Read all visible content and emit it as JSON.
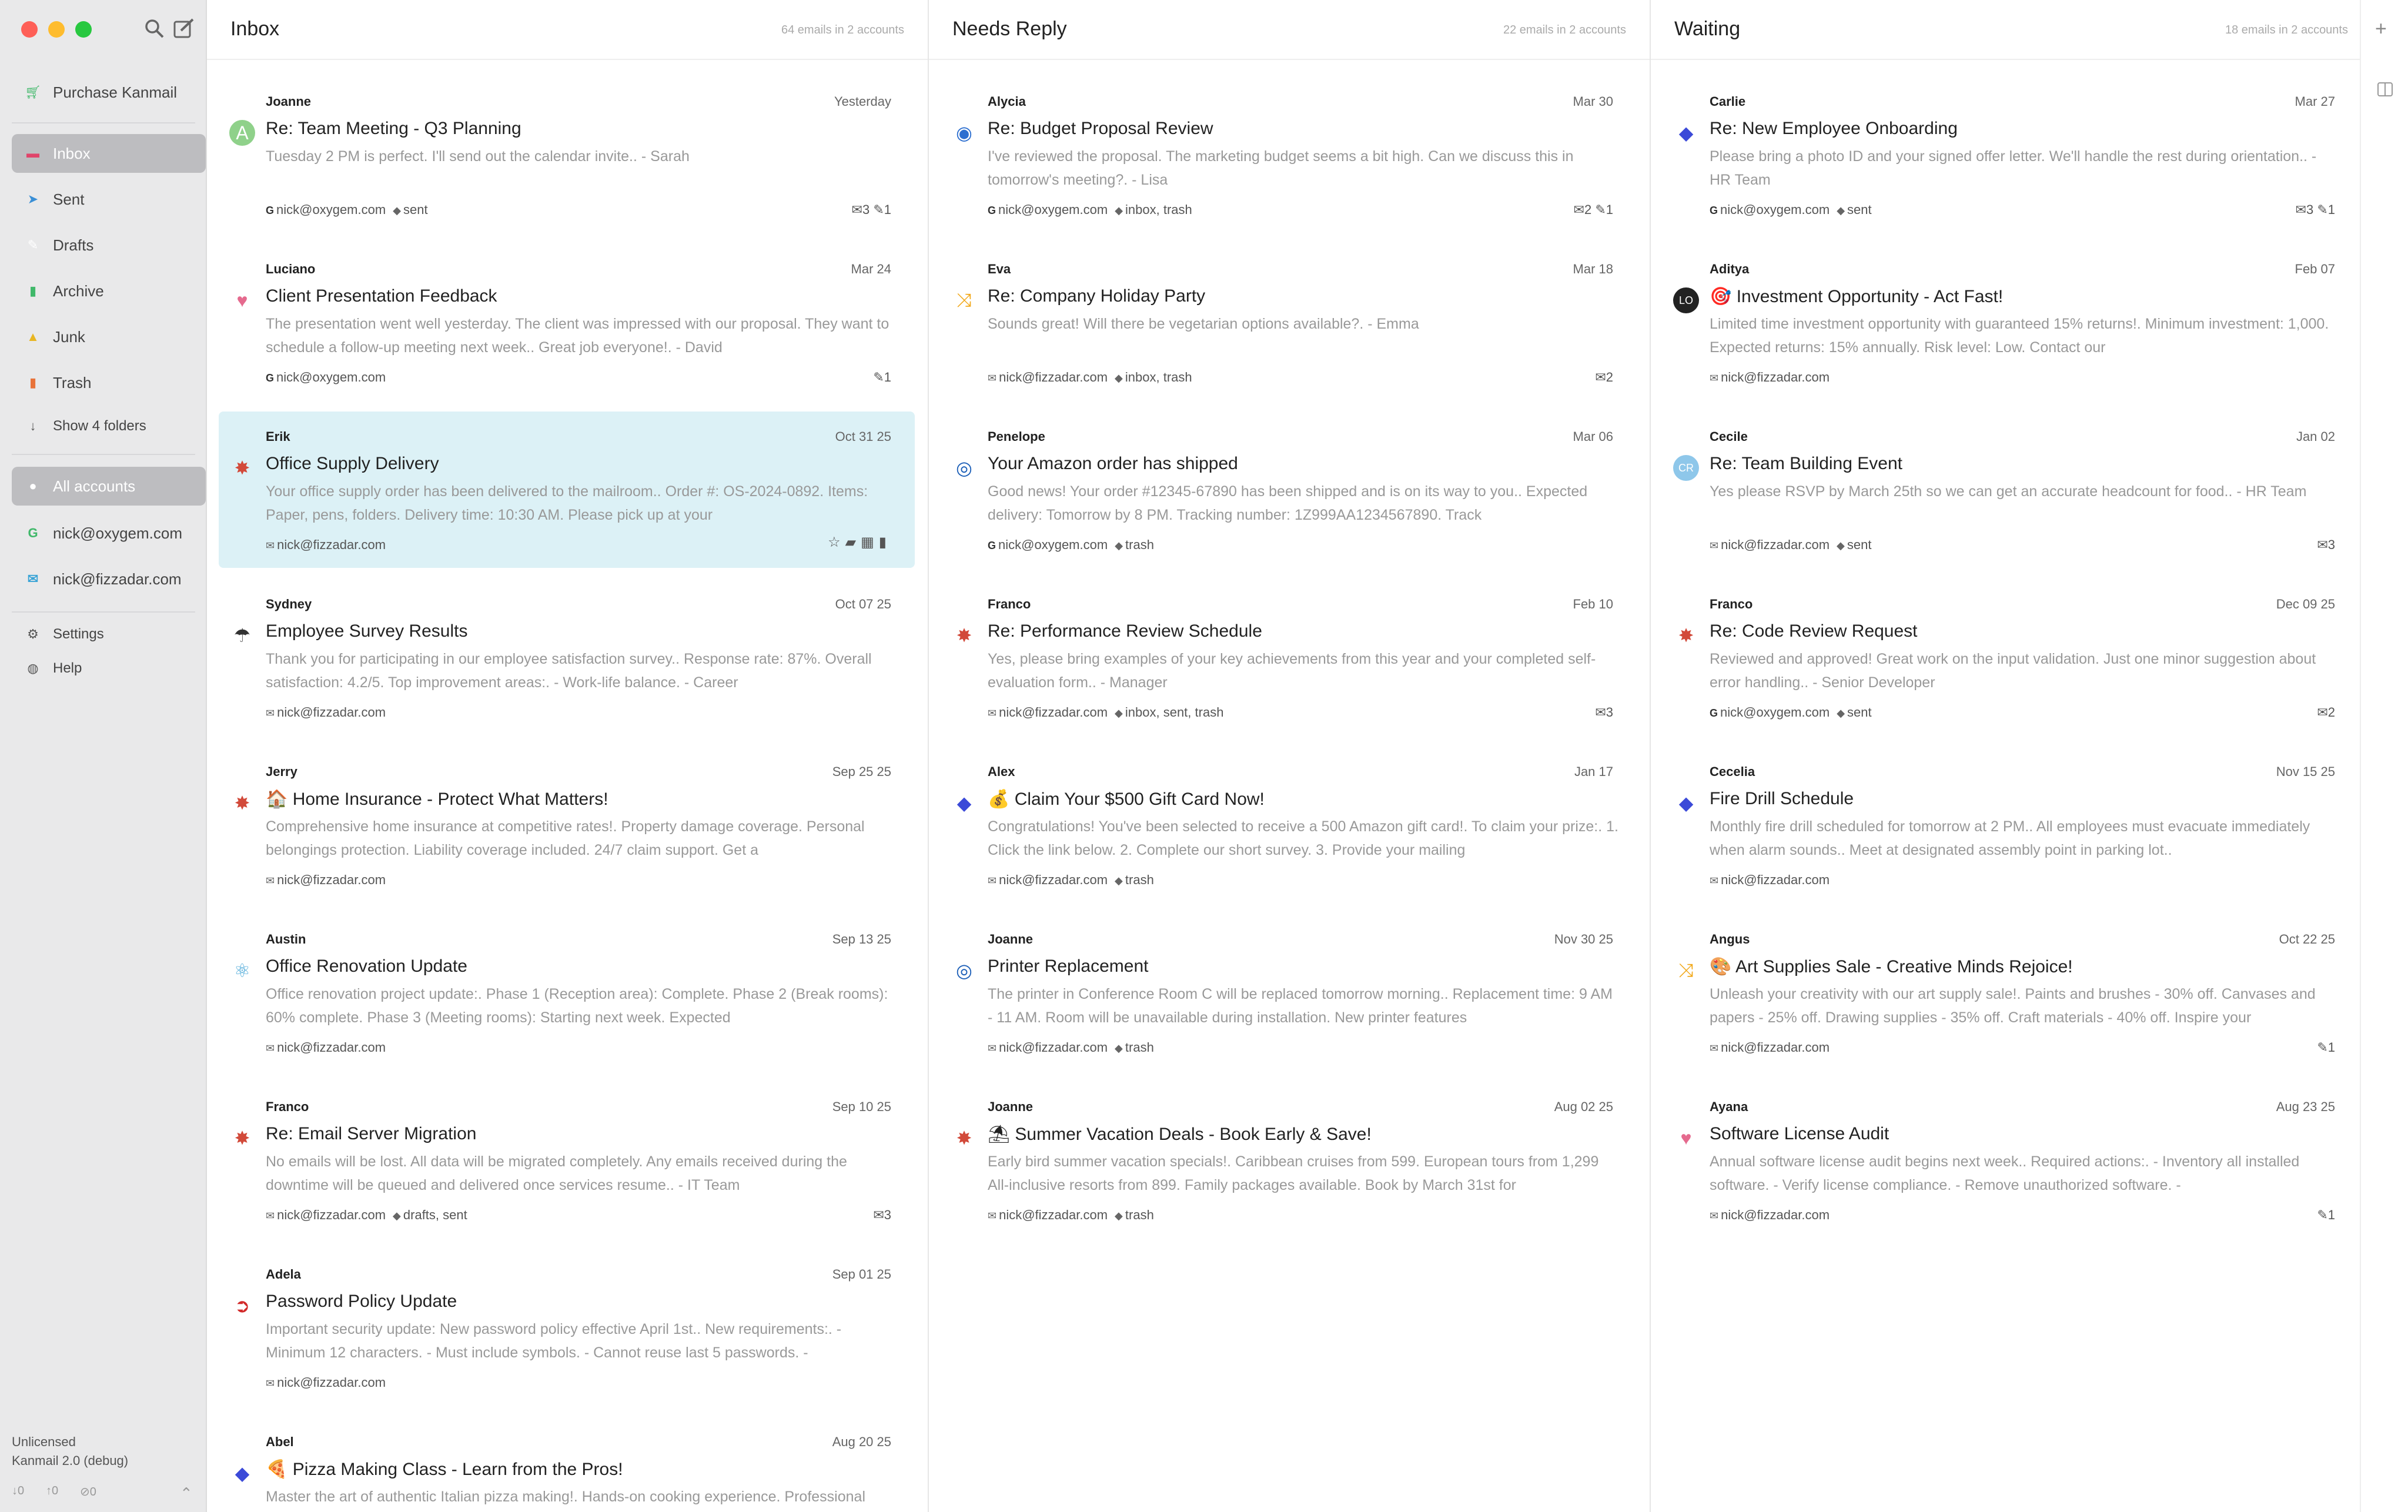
{
  "sidebar": {
    "purchase": "Purchase Kanmail",
    "folders": [
      {
        "label": "Inbox",
        "icon": "inbox-icon",
        "color": "#e0446a",
        "active": true
      },
      {
        "label": "Sent",
        "icon": "paper-plane-icon",
        "color": "#3a8fd6"
      },
      {
        "label": "Drafts",
        "icon": "pencil-icon",
        "color": "#ffffff"
      },
      {
        "label": "Archive",
        "icon": "archive-icon",
        "color": "#40b86a"
      },
      {
        "label": "Junk",
        "icon": "warning-icon",
        "color": "#e8b623"
      },
      {
        "label": "Trash",
        "icon": "trash-icon",
        "color": "#e8733a"
      }
    ],
    "show_folders": "Show 4 folders",
    "all_accounts": "All accounts",
    "accounts": [
      {
        "label": "nick@oxygem.com",
        "icon": "google-icon",
        "color": "#40b86a"
      },
      {
        "label": "nick@fizzadar.com",
        "icon": "envelope-icon",
        "color": "#3aa4d6"
      }
    ],
    "settings": "Settings",
    "help": "Help",
    "license": "Unlicensed",
    "version": "Kanmail 2.0 (debug)",
    "counters": [
      "0",
      "0",
      "0"
    ]
  },
  "columns": [
    {
      "title": "Inbox",
      "count": "64 emails in 2 accounts",
      "emails": [
        {
          "sender": "Joanne",
          "date": "Yesterday",
          "subject": "Re: Team Meeting - Q3 Planning",
          "preview": "Tuesday 2 PM is perfect. I'll send out the calendar invite.. - Sarah",
          "account": "nick@oxygem.com",
          "account_icon": "google-icon",
          "tags": "sent",
          "counts": "✉3 ✎1",
          "logo": "A",
          "logo_color": "#8fd18a"
        },
        {
          "sender": "Luciano",
          "date": "Mar 24",
          "subject": "Client Presentation Feedback",
          "preview": "The presentation went well yesterday. The client was impressed with our proposal. They want to schedule a follow-up meeting next week.. Great job everyone!. - David",
          "account": "nick@oxygem.com",
          "account_icon": "google-icon",
          "tags": "",
          "counts": "✎1",
          "logo": "♥",
          "logo_color": "#e56a8e"
        },
        {
          "sender": "Erik",
          "date": "Oct 31 25",
          "subject": "Office Supply Delivery",
          "preview": "Your office supply order has been delivered to the mailroom.. Order #: OS-2024-0892. Items: Paper, pens, folders. Delivery time: 10:30 AM. Please pick up at your",
          "account": "nick@fizzadar.com",
          "account_icon": "envelope-icon",
          "tags": "",
          "counts": "",
          "selected": true,
          "logo": "✸",
          "logo_color": "#d24a3a"
        },
        {
          "sender": "Sydney",
          "date": "Oct 07 25",
          "subject": "Employee Survey Results",
          "preview": "Thank you for participating in our employee satisfaction survey.. Response rate: 87%. Overall satisfaction: 4.2/5. Top improvement areas:. - Work-life balance. - Career",
          "account": "nick@fizzadar.com",
          "account_icon": "envelope-icon",
          "tags": "",
          "counts": "",
          "logo": "☂",
          "logo_color": "#333333"
        },
        {
          "sender": "Jerry",
          "date": "Sep 25 25",
          "subject": "🏠 Home Insurance - Protect What Matters!",
          "preview": "Comprehensive home insurance at competitive rates!. Property damage coverage. Personal belongings protection. Liability coverage included. 24/7 claim support. Get a",
          "account": "nick@fizzadar.com",
          "account_icon": "envelope-icon",
          "tags": "",
          "counts": "",
          "logo": "✸",
          "logo_color": "#d24a3a"
        },
        {
          "sender": "Austin",
          "date": "Sep 13 25",
          "subject": "Office Renovation Update",
          "preview": "Office renovation project update:. Phase 1 (Reception area): Complete. Phase 2 (Break rooms): 60% complete. Phase 3 (Meeting rooms): Starting next week. Expected",
          "account": "nick@fizzadar.com",
          "account_icon": "envelope-icon",
          "tags": "",
          "counts": "",
          "logo": "⚛",
          "logo_color": "#4aa8d8"
        },
        {
          "sender": "Franco",
          "date": "Sep 10 25",
          "subject": "Re: Email Server Migration",
          "preview": "No emails will be lost. All data will be migrated completely. Any emails received during the downtime will be queued and delivered once services resume.. - IT Team",
          "account": "nick@fizzadar.com",
          "account_icon": "envelope-icon",
          "tags": "drafts, sent",
          "counts": "✉3",
          "logo": "✸",
          "logo_color": "#d24a3a"
        },
        {
          "sender": "Adela",
          "date": "Sep 01 25",
          "subject": "Password Policy Update",
          "preview": "Important security update: New password policy effective April 1st.. New requirements:. - Minimum 12 characters. - Must include symbols. - Cannot reuse last 5 passwords. -",
          "account": "nick@fizzadar.com",
          "account_icon": "envelope-icon",
          "tags": "",
          "counts": "",
          "logo": "➲",
          "logo_color": "#d22a2a"
        },
        {
          "sender": "Abel",
          "date": "Aug 20 25",
          "subject": "🍕 Pizza Making Class - Learn from the Pros!",
          "preview": "Master the art of authentic Italian pizza making!. Hands-on cooking experience. Professional chef instructors. All ingredients provided. Take home your creations",
          "account": "nick@fizzadar.com",
          "account_icon": "envelope-icon",
          "tags": "",
          "counts": "",
          "logo": "◆",
          "logo_color": "#3b4ad8"
        }
      ]
    },
    {
      "title": "Needs Reply",
      "count": "22 emails in 2 accounts",
      "emails": [
        {
          "sender": "Alycia",
          "date": "Mar 30",
          "subject": "Re: Budget Proposal Review",
          "preview": "I've reviewed the proposal. The marketing budget seems a bit high. Can we discuss this in tomorrow's meeting?. - Lisa",
          "account": "nick@oxygem.com",
          "account_icon": "google-icon",
          "tags": "inbox, trash",
          "counts": "✉2 ✎1",
          "logo": "◉",
          "logo_color": "#2d6fd0"
        },
        {
          "sender": "Eva",
          "date": "Mar 18",
          "subject": "Re: Company Holiday Party",
          "preview": "Sounds great! Will there be vegetarian options available?. - Emma",
          "account": "nick@fizzadar.com",
          "account_icon": "envelope-icon",
          "tags": "inbox, trash",
          "counts": "✉2",
          "logo": "⤨",
          "logo_color": "#f2a91c"
        },
        {
          "sender": "Penelope",
          "date": "Mar 06",
          "subject": "Your Amazon order has shipped",
          "preview": "Good news! Your order #12345-67890 has been shipped and is on its way to you.. Expected delivery: Tomorrow by 8 PM. Tracking number: 1Z999AA1234567890. Track",
          "account": "nick@oxygem.com",
          "account_icon": "google-icon",
          "tags": "trash",
          "counts": "",
          "logo": "◎",
          "logo_color": "#1c5fb8"
        },
        {
          "sender": "Franco",
          "date": "Feb 10",
          "subject": "Re: Performance Review Schedule",
          "preview": "Yes, please bring examples of your key achievements from this year and your completed self-evaluation form.. - Manager",
          "account": "nick@fizzadar.com",
          "account_icon": "envelope-icon",
          "tags": "inbox, sent, trash",
          "counts": "✉3",
          "logo": "✸",
          "logo_color": "#d24a3a"
        },
        {
          "sender": "Alex",
          "date": "Jan 17",
          "subject": "💰 Claim Your $500 Gift Card Now!",
          "preview": "Congratulations! You've been selected to receive a 500 Amazon gift card!. To claim your prize:. 1. Click the link below. 2. Complete our short survey. 3. Provide your mailing",
          "account": "nick@fizzadar.com",
          "account_icon": "envelope-icon",
          "tags": "trash",
          "counts": "",
          "logo": "◆",
          "logo_color": "#3b4ad8"
        },
        {
          "sender": "Joanne",
          "date": "Nov 30 25",
          "subject": "Printer Replacement",
          "preview": "The printer in Conference Room C will be replaced tomorrow morning.. Replacement time: 9 AM - 11 AM. Room will be unavailable during installation. New printer features",
          "account": "nick@fizzadar.com",
          "account_icon": "envelope-icon",
          "tags": "trash",
          "counts": "",
          "logo": "◎",
          "logo_color": "#1c5fb8"
        },
        {
          "sender": "Joanne",
          "date": "Aug 02 25",
          "subject": "⛱ Summer Vacation Deals - Book Early & Save!",
          "preview": "Early bird summer vacation specials!. Caribbean cruises from 599. European tours from 1,299 All-inclusive resorts from 899. Family packages available. Book by March 31st for",
          "account": "nick@fizzadar.com",
          "account_icon": "envelope-icon",
          "tags": "trash",
          "counts": "",
          "logo": "✸",
          "logo_color": "#d24a3a"
        }
      ]
    },
    {
      "title": "Waiting",
      "count": "18 emails in 2 accounts",
      "emails": [
        {
          "sender": "Carlie",
          "date": "Mar 27",
          "subject": "Re: New Employee Onboarding",
          "preview": "Please bring a photo ID and your signed offer letter. We'll handle the rest during orientation.. - HR Team",
          "account": "nick@oxygem.com",
          "account_icon": "google-icon",
          "tags": "sent",
          "counts": "✉3 ✎1",
          "logo": "◆",
          "logo_color": "#3b4ad8"
        },
        {
          "sender": "Aditya",
          "date": "Feb 07",
          "subject": "🎯 Investment Opportunity - Act Fast!",
          "preview": "Limited time investment opportunity with guaranteed 15% returns!. Minimum investment: 1,000. Expected returns: 15% annually. Risk level: Low. Contact our",
          "account": "nick@fizzadar.com",
          "account_icon": "envelope-icon",
          "tags": "",
          "counts": "",
          "logo": "LO",
          "logo_color": "#222222"
        },
        {
          "sender": "Cecile",
          "date": "Jan 02",
          "subject": "Re: Team Building Event",
          "preview": "Yes please RSVP by March 25th so we can get an accurate headcount for food.. - HR Team",
          "account": "nick@fizzadar.com",
          "account_icon": "envelope-icon",
          "tags": "sent",
          "counts": "✉3",
          "logo": "CR",
          "logo_color": "#8ec7ea"
        },
        {
          "sender": "Franco",
          "date": "Dec 09 25",
          "subject": "Re: Code Review Request",
          "preview": "Reviewed and approved! Great work on the input validation. Just one minor suggestion about error handling.. - Senior Developer",
          "account": "nick@oxygem.com",
          "account_icon": "google-icon",
          "tags": "sent",
          "counts": "✉2",
          "logo": "✸",
          "logo_color": "#d24a3a"
        },
        {
          "sender": "Cecelia",
          "date": "Nov 15 25",
          "subject": "Fire Drill Schedule",
          "preview": "Monthly fire drill scheduled for tomorrow at 2 PM.. All employees must evacuate immediately when alarm sounds.. Meet at designated assembly point in parking lot..",
          "account": "nick@fizzadar.com",
          "account_icon": "envelope-icon",
          "tags": "",
          "counts": "",
          "logo": "◆",
          "logo_color": "#3b4ad8"
        },
        {
          "sender": "Angus",
          "date": "Oct 22 25",
          "subject": "🎨 Art Supplies Sale - Creative Minds Rejoice!",
          "preview": "Unleash your creativity with our art supply sale!. Paints and brushes - 30% off. Canvases and papers - 25% off. Drawing supplies - 35% off. Craft materials - 40% off. Inspire your",
          "account": "nick@fizzadar.com",
          "account_icon": "envelope-icon",
          "tags": "",
          "counts": "✎1",
          "logo": "⤨",
          "logo_color": "#f2a91c"
        },
        {
          "sender": "Ayana",
          "date": "Aug 23 25",
          "subject": "Software License Audit",
          "preview": "Annual software license audit begins next week.. Required actions:. - Inventory all installed software. - Verify license compliance. - Remove unauthorized software. -",
          "account": "nick@fizzadar.com",
          "account_icon": "envelope-icon",
          "tags": "",
          "counts": "✎1",
          "logo": "♥",
          "logo_color": "#e56a8e"
        }
      ]
    }
  ]
}
